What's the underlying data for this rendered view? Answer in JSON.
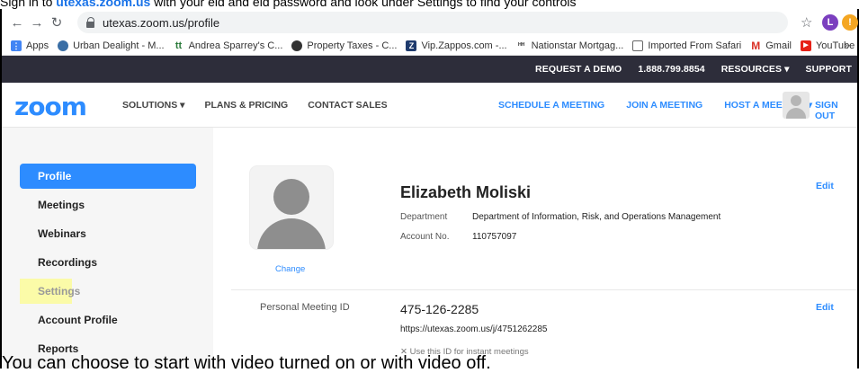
{
  "caption": {
    "top_prefix": "Sign in to ",
    "top_link": "utexas.zoom.us",
    "top_suffix": " with your eid and eid password and look under Settings to find your controls",
    "bottom": "You can choose to start with video turned on or with video off."
  },
  "browser": {
    "url": "utexas.zoom.us/profile",
    "profile_initial": "L",
    "bookmarks": [
      {
        "label": "Apps",
        "icon": "apps-grid-icon"
      },
      {
        "label": "Urban Dealight - M...",
        "icon": "urban-dealight-icon"
      },
      {
        "label": "Andrea Sparrey's C...",
        "icon": "tt-icon"
      },
      {
        "label": "Property Taxes - C...",
        "icon": "property-taxes-icon"
      },
      {
        "label": "Vip.Zappos.com -...",
        "icon": "zappos-icon"
      },
      {
        "label": "Nationstar Mortgag...",
        "icon": "nationstar-icon"
      },
      {
        "label": "Imported From Safari",
        "icon": "folder-icon"
      },
      {
        "label": "Gmail",
        "icon": "gmail-icon"
      },
      {
        "label": "YouTube",
        "icon": "youtube-icon"
      }
    ],
    "more": "»"
  },
  "zoom_topbar": {
    "request_demo": "REQUEST A DEMO",
    "phone": "1.888.799.8854",
    "resources": "RESOURCES ▾",
    "support": "SUPPORT"
  },
  "zoom_nav": {
    "logo": "zoom",
    "solutions": "SOLUTIONS ▾",
    "plans": "PLANS & PRICING",
    "contact": "CONTACT SALES",
    "schedule": "SCHEDULE A MEETING",
    "join": "JOIN A MEETING",
    "host": "HOST A MEETING ▾",
    "signout": "SIGN OUT"
  },
  "sidebar": {
    "items": [
      {
        "label": "Profile",
        "active": true
      },
      {
        "label": "Meetings"
      },
      {
        "label": "Webinars"
      },
      {
        "label": "Recordings"
      },
      {
        "label": "Settings",
        "highlighted": true
      },
      {
        "label": "Account Profile"
      },
      {
        "label": "Reports"
      }
    ]
  },
  "profile": {
    "change_label": "Change",
    "name": "Elizabeth Moliski",
    "department_label": "Department",
    "department_value": "Department of Information, Risk, and Operations Management",
    "account_label": "Account No.",
    "account_value": "110757097",
    "edit_label": "Edit"
  },
  "pmi": {
    "label": "Personal Meeting ID",
    "value": "475-126-2285",
    "url": "https://utexas.zoom.us/j/4751262285",
    "instant_label": "Use this ID for instant meetings",
    "edit_label": "Edit"
  },
  "colors": {
    "zoom_blue": "#2d8cff",
    "topbar_bg": "#2d2d3a",
    "highlight": "#fbfba8"
  }
}
